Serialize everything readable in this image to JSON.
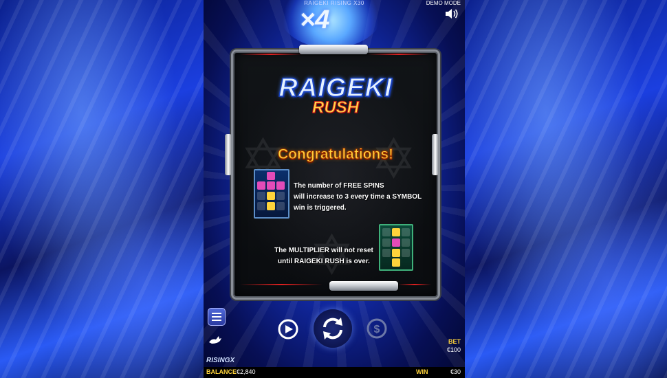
{
  "header": {
    "game_title": "RAIGEKI RISING X30",
    "mode": "DEMO MODE",
    "sound_icon": "speaker-icon"
  },
  "multiplier": {
    "display": "×4"
  },
  "popup": {
    "logo_main": "RAIGEKI",
    "logo_sub": "RUSH",
    "headline": "Congratulations!",
    "line1": "The number of FREE SPINS",
    "line2": "will increase to 3 every time a SYMBOL",
    "line3": "win is triggered.",
    "line4": "The MULTIPLIER will not reset",
    "line5": "until RAIGEKI RUSH is over."
  },
  "controls": {
    "menu_icon": "hamburger-menu-icon",
    "turbo_icon": "rabbit-icon",
    "autoplay_icon": "autoplay-icon",
    "spin_icon": "spin-arrows-icon",
    "bet_icon": "dollar-coin-icon"
  },
  "footer": {
    "brand": "RISINGX",
    "balance_label": "BALANCE",
    "balance_value": "€2,840",
    "win_label": "WIN",
    "win_value": "€30",
    "bet_label": "BET",
    "bet_value": "€100"
  },
  "colors": {
    "accent_gold": "#ffd43b",
    "panel_frame": "#8a8f98",
    "background_blue": "#1430b8"
  }
}
